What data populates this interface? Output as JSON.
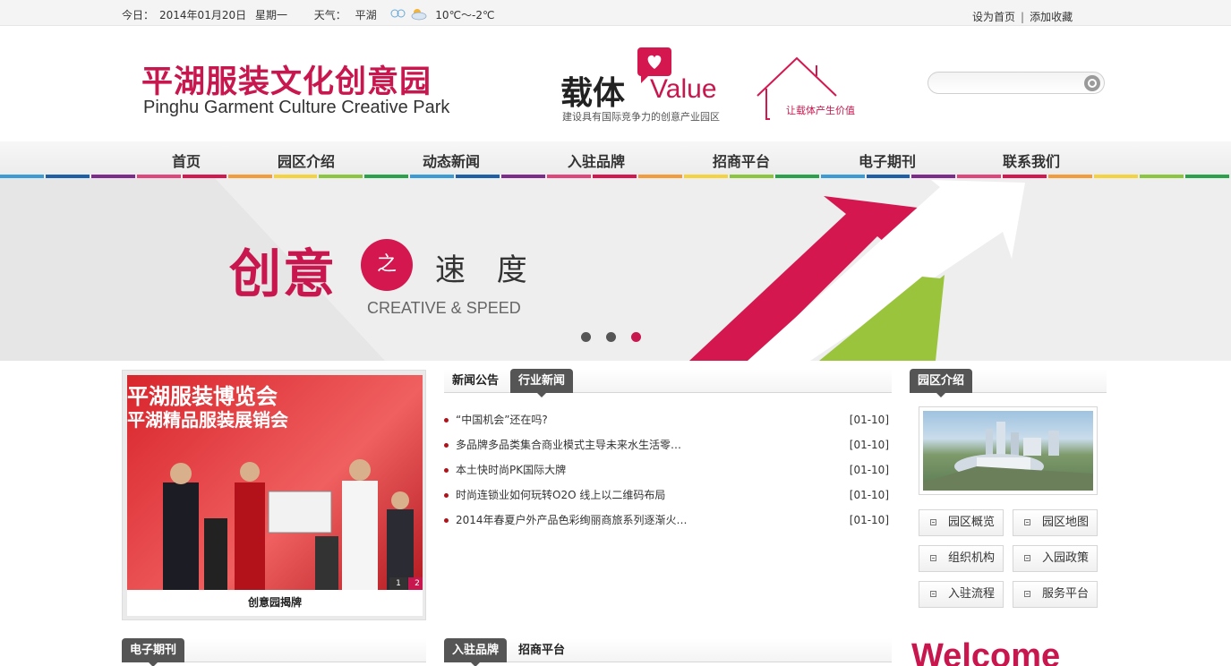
{
  "topbar": {
    "date_label": "今日：",
    "date": "2014年01月20日",
    "weekday": "星期一",
    "weather_label": "天气：",
    "city": "平湖",
    "weather_icon": "cloudy-rain-icon",
    "temperature": "10℃～-2℃",
    "set_home": "设为首页",
    "separator": "|",
    "add_favorite": "添加收藏"
  },
  "header": {
    "logo_cn": "平湖服装文化创意园",
    "logo_en": "Pinghu Garment Culture Creative Park",
    "slogan_cn": "载体",
    "slogan_en": "Value",
    "slogan_sub": "建设具有国际竞争力的创意产业园区",
    "house_text": "让载体产生价值",
    "search_placeholder": ""
  },
  "nav": {
    "items": [
      "首页",
      "园区介绍",
      "动态新闻",
      "入驻品牌",
      "招商平台",
      "电子期刊",
      "联系我们"
    ],
    "stripe_colors": [
      "#3a9bd5",
      "#1f5fa8",
      "#7d2c8c",
      "#e0457b",
      "#d4184f",
      "#f39c3b",
      "#f5d33f",
      "#8cc63f",
      "#2aa14b",
      "#3a9bd5",
      "#1f5fa8",
      "#7d2c8c",
      "#e0457b",
      "#d4184f",
      "#f39c3b",
      "#f5d33f",
      "#8cc63f",
      "#2aa14b",
      "#3a9bd5",
      "#1f5fa8",
      "#7d2c8c",
      "#e0457b",
      "#d4184f",
      "#f39c3b",
      "#f5d33f",
      "#8cc63f",
      "#2aa14b"
    ]
  },
  "banner": {
    "title": "创意",
    "connector": "之",
    "subtitle": "速 度",
    "english": "CREATIVE & SPEED",
    "slide_count": 3,
    "active_slide": 3
  },
  "photo": {
    "title_line1": "平湖服装博览会",
    "title_line2": "平湖精品服装展销会",
    "pager": [
      "1",
      "2"
    ],
    "active_page": "2",
    "caption": "创意园揭牌"
  },
  "news": {
    "tabs": [
      "新闻公告",
      "行业新闻"
    ],
    "active_tab": "行业新闻",
    "items": [
      {
        "title": "“中国机会”还在吗?",
        "date": "[01-10]"
      },
      {
        "title": "多品牌多品类集合商业模式主导未来水生活零…",
        "date": "[01-10]"
      },
      {
        "title": "本土快时尚PK国际大牌",
        "date": "[01-10]"
      },
      {
        "title": "时尚连锁业如何玩转O2O 线上以二维码布局",
        "date": "[01-10]"
      },
      {
        "title": "2014年春夏户外产品色彩绚丽商旅系列逐渐火…",
        "date": "[01-10]"
      }
    ]
  },
  "park": {
    "tab": "园区介绍",
    "links": [
      "园区概览",
      "园区地图",
      "组织机构",
      "入园政策",
      "入驻流程",
      "服务平台"
    ]
  },
  "bottom": {
    "ejournal_tab": "电子期刊",
    "brand_tabs": [
      "入驻品牌",
      "招商平台"
    ],
    "welcome": "Welcome"
  }
}
